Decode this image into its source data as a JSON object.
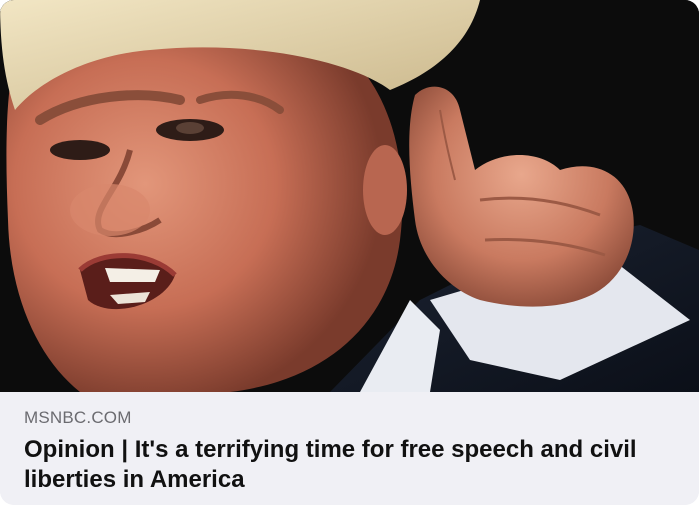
{
  "link_preview": {
    "source": "MSNBC.COM",
    "headline": "Opinion | It's a terrifying time for free speech and civil liberties in America",
    "image_subject": "close-up photo of a man shouting and pointing at the camera"
  },
  "colors": {
    "caption_background": "#f0f0f5",
    "source_text": "#6b6b70",
    "headline_text": "#111111",
    "photo_background": "#0c0c0c"
  }
}
